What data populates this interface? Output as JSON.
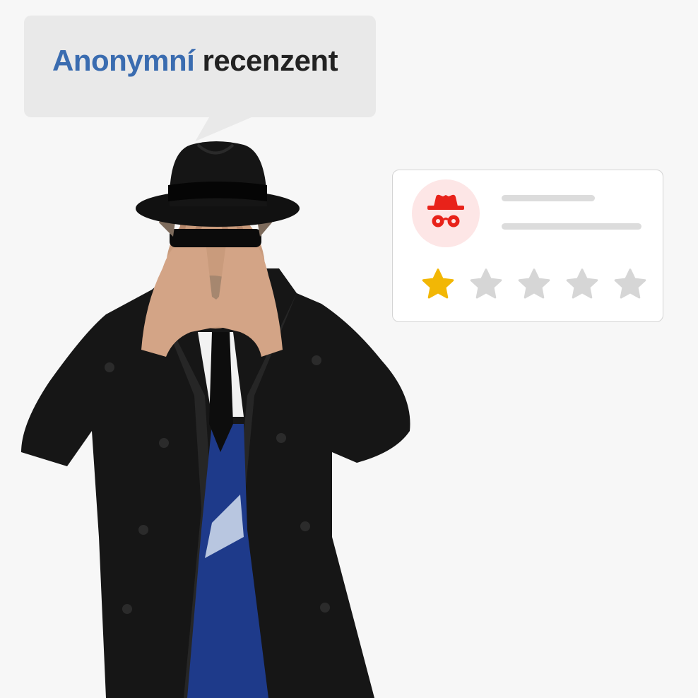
{
  "bubble": {
    "accent_word": "Anonymní",
    "rest_word": "recenzent",
    "accent_color": "#3a6cb0",
    "background": "#e9e9e9"
  },
  "review_card": {
    "avatar_icon": "incognito-icon",
    "avatar_icon_color": "#e8221a",
    "avatar_bg": "#fde6e6",
    "rating": 1,
    "max_rating": 5,
    "filled_star_color": "#f2b705",
    "empty_star_color": "#d6d6d6"
  },
  "figure": {
    "description_icon": "man-in-hat-hiding-face"
  }
}
